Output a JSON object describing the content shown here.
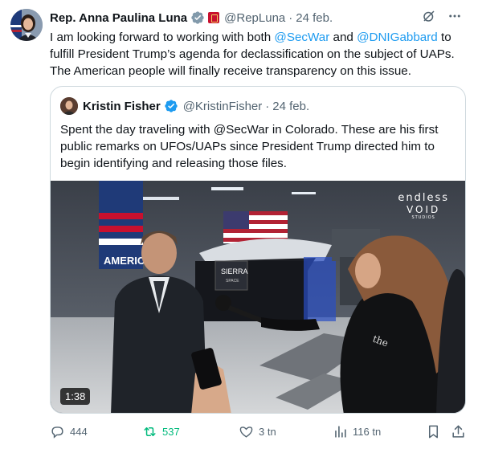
{
  "tweet": {
    "author_name": "Rep. Anna Paulina Luna",
    "handle": "@RepLuna",
    "separator": "·",
    "date": "24 feb.",
    "text_1": "I am looking forward to working with both ",
    "mention_1": "@SecWar",
    "text_2": " and ",
    "mention_2": "@DNIGabbard",
    "text_3": " to fulfill President Trump’s agenda for declassification on the subject of UAPs. The American people will finally receive transparency on this issue."
  },
  "quoted": {
    "author_name": "Kristin Fisher",
    "handle": "@KristinFisher",
    "separator": "·",
    "date": "24 feb.",
    "text": "Spent the day traveling with @SecWar in Colorado. These are his first public remarks on UFOs/UAPs since President Trump directed him to begin identifying and releasing those files.",
    "video_duration": "1:38",
    "watermark_line1": "endless",
    "watermark_line2": "VOID",
    "watermark_line3": "STUDIOS",
    "backdrop_sign": "SIERRA",
    "backdrop_sub": "SPACE",
    "banner_text": "AMERIC"
  },
  "actions": {
    "replies": "444",
    "reposts": "537",
    "likes": "3 tn",
    "views": "116 tn"
  },
  "colors": {
    "link": "#1d9bf0",
    "repost": "#00ba7c",
    "muted": "#536471",
    "verified_gray": "#829aab",
    "verified_blue": "#1d9bf0"
  }
}
